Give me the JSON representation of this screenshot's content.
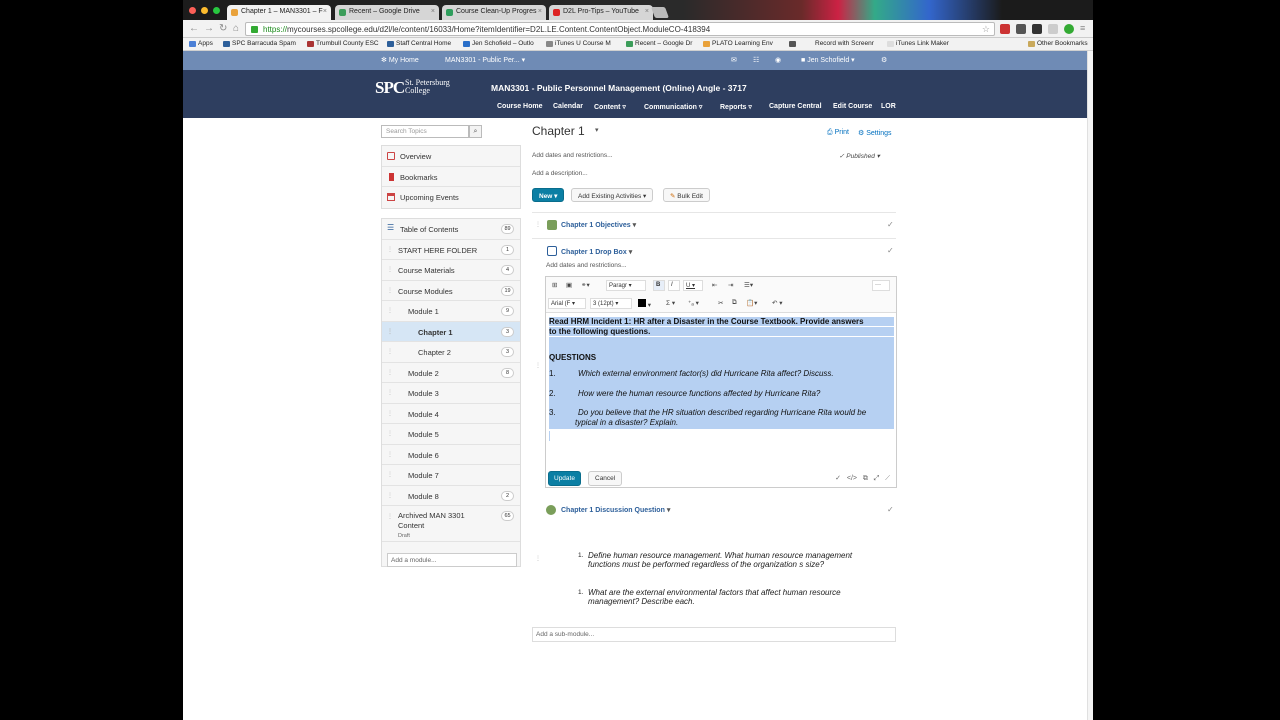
{
  "browser": {
    "tabs": [
      {
        "label": "Chapter 1 – MAN3301 – F",
        "active": true,
        "color": "#e9a23b"
      },
      {
        "label": "Recent – Google Drive",
        "active": false,
        "color": "#3c9d5a"
      },
      {
        "label": "Course Clean-Up Progres",
        "active": false,
        "color": "#2f9e5d"
      },
      {
        "label": "D2L Pro-Tips – YouTube",
        "active": false,
        "color": "#d22"
      }
    ],
    "url_scheme": "https://",
    "url_rest": "mycourses.spcollege.edu/d2l/le/content/16033/Home?itemIdentifier=D2L.LE.Content.ContentObject.ModuleCO-418394",
    "bookmarks": [
      "Apps",
      "SPC Barracuda Spam",
      "Trumbull County ESC",
      "Staff Central Home",
      "Jen Schofield – Outlo",
      "iTunes U Course M",
      "Recent – Google Dr",
      "PLATO Learning Env",
      "",
      "Record with Screenr",
      "iTunes Link Maker"
    ],
    "other_bookmarks": "Other Bookmarks"
  },
  "minibar": {
    "home": "My Home",
    "course": "MAN3301 - Public Per...",
    "user": "Jen Schofield"
  },
  "header": {
    "logo_main": "SPC",
    "logo_line1": "St. Petersburg",
    "logo_line2": "College",
    "course_title": "MAN3301 - Public Personnel Management (Online) Angle - 3717",
    "nav": [
      "Course Home",
      "Calendar",
      "Content ▿",
      "Communication ▿",
      "Reports ▿",
      "Capture Central",
      "Edit Course",
      "LOR"
    ]
  },
  "sidebar": {
    "search_placeholder": "Search Topics",
    "top_items": [
      "Overview",
      "Bookmarks",
      "Upcoming Events"
    ],
    "toc": [
      {
        "label": "Table of Contents",
        "count": "89"
      },
      {
        "label": "START HERE FOLDER",
        "count": "1"
      },
      {
        "label": "Course Materials",
        "count": "4"
      },
      {
        "label": "Course Modules",
        "count": "19"
      },
      {
        "label": "Module 1",
        "count": "9"
      },
      {
        "label": "Chapter 1",
        "count": "3"
      },
      {
        "label": "Chapter 2",
        "count": "3"
      },
      {
        "label": "Module 2",
        "count": "8"
      },
      {
        "label": "Module 3",
        "count": ""
      },
      {
        "label": "Module 4",
        "count": ""
      },
      {
        "label": "Module 5",
        "count": ""
      },
      {
        "label": "Module 6",
        "count": ""
      },
      {
        "label": "Module 7",
        "count": ""
      },
      {
        "label": "Module 8",
        "count": "2"
      }
    ],
    "archived_label_1": "Archived MAN 3301",
    "archived_label_2": "Content",
    "archived_count": "65",
    "archived_status": "Draft",
    "add_module_placeholder": "Add a module..."
  },
  "main": {
    "title": "Chapter 1",
    "print": "Print",
    "settings": "Settings",
    "add_dates": "Add dates and restrictions...",
    "published": "Published",
    "add_description": "Add a description...",
    "new_btn": "New",
    "add_existing": "Add Existing Activities",
    "bulk_edit": "Bulk Edit",
    "topic1": "Chapter 1 Objectives",
    "topic2": "Chapter 1 Drop Box",
    "topic2_dates": "Add dates and restrictions...",
    "editor": {
      "paragraph": "Paragr",
      "font": "Arial (F",
      "size": "3 (12pt)",
      "line1": "Read HRM Incident 1: HR after a Disaster in the Course Textbook.  Provide answers",
      "line2": "to the following questions.",
      "questions_heading": "QUESTIONS",
      "q1_num": "1.",
      "q1": "Which external environment factor(s) did Hurricane Rita affect? Discuss.",
      "q2_num": "2.",
      "q2": "How were the human resource functions affected by Hurricane Rita?",
      "q3_num": "3.",
      "q3a": "Do you believe that the HR situation described regarding Hurricane Rita would be",
      "q3b": "typical in a disaster? Explain.",
      "update": "Update",
      "cancel": "Cancel"
    },
    "topic3": "Chapter 1 Discussion Question",
    "dq1_num": "1.",
    "dq1a": "Define human resource management. What human resource management",
    "dq1b": "functions must be performed regardless of the organization s size?",
    "dq2_num": "1.",
    "dq2a": "What are the external environmental factors that affect human resource",
    "dq2b": "management? Describe each.",
    "add_submodule": "Add a sub-module..."
  }
}
